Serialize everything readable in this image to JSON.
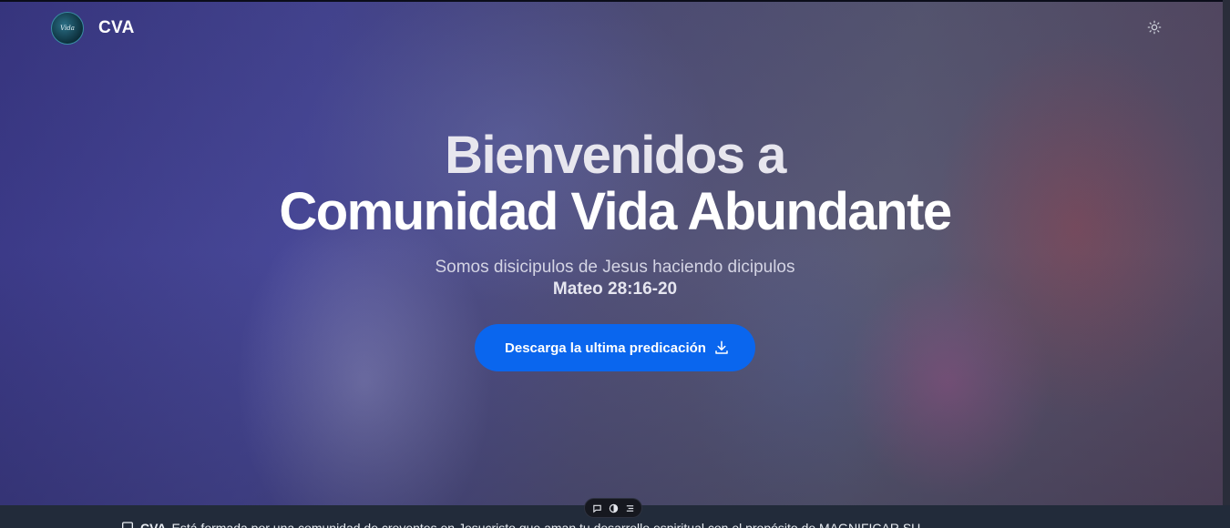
{
  "navbar": {
    "logo_text": "Vida",
    "brand": "CVA",
    "theme_toggle_icon": "sun-icon"
  },
  "hero": {
    "title_line_1": "Bienvenidos a",
    "title_line_2": "Comunidad Vida Abundante",
    "subtitle": "Somos disicipulos de Jesus haciendo dicipulos",
    "verse": "Mateo 28:16-20",
    "cta_label": "Descarga la ultima predicación",
    "cta_icon": "download-icon"
  },
  "footer_strip": {
    "brand": "CVA",
    "text": "Está formada por una comunidad de creyentes en Jesucristo que aman tu desarrollo espiritual con el propósito de MAGNIFICAR SU..."
  },
  "floating_toolbar": {
    "icons": [
      "chat-icon",
      "contrast-icon",
      "list-icon"
    ]
  },
  "colors": {
    "accent": "#0a66ee",
    "footer_bg": "#222b3a"
  }
}
